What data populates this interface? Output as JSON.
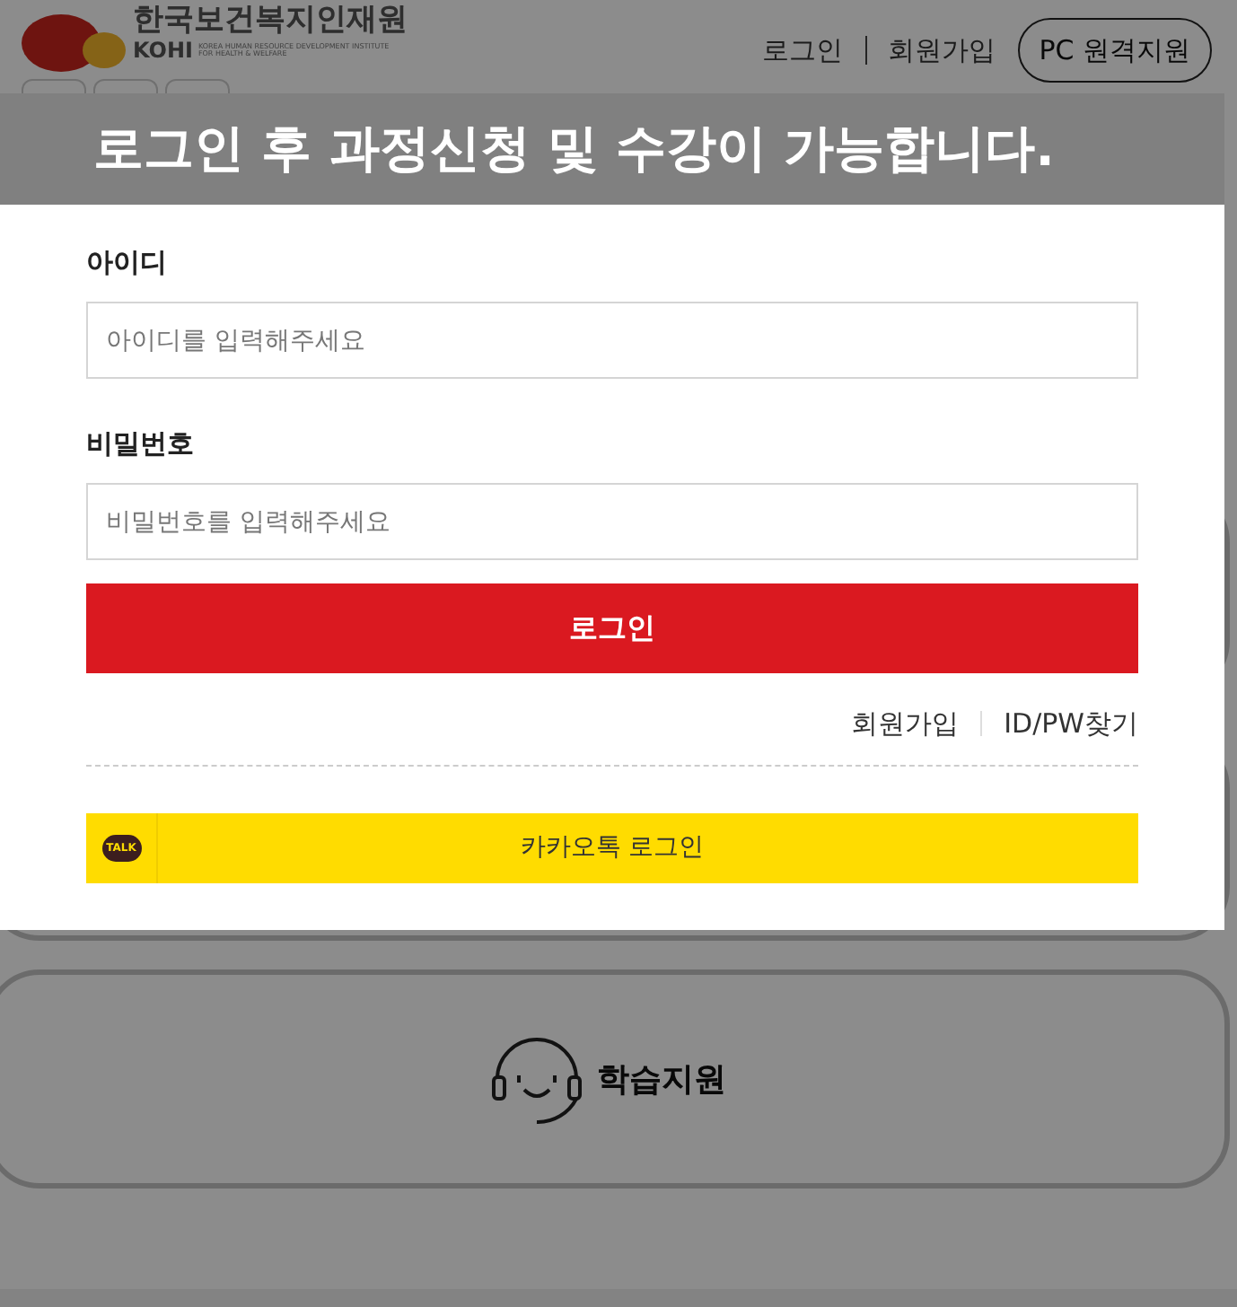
{
  "header": {
    "logo": {
      "name": "한국보건복지인재원",
      "abbr": "KOHI",
      "subtitle": "KOREA HUMAN RESOURCE DEVELOPMENT INSTITUTE FOR HEALTH & WELFARE"
    },
    "links": [
      "로그인",
      "회원가입"
    ],
    "remote_button": "PC 원격지원"
  },
  "cards": [
    {
      "label": "학습지원"
    }
  ],
  "modal": {
    "title": "로그인 후 과정신청 및 수강이 가능합니다.",
    "fields": [
      {
        "label": "아이디",
        "placeholder": "아이디를 입력해주세요"
      },
      {
        "label": "비밀번호",
        "placeholder": "비밀번호를 입력해주세요"
      }
    ],
    "login_button": "로그인",
    "links": [
      "회원가입",
      "ID/PW찾기"
    ],
    "kakao": {
      "icon_text": "TALK",
      "label": "카카오톡 로그인"
    }
  }
}
